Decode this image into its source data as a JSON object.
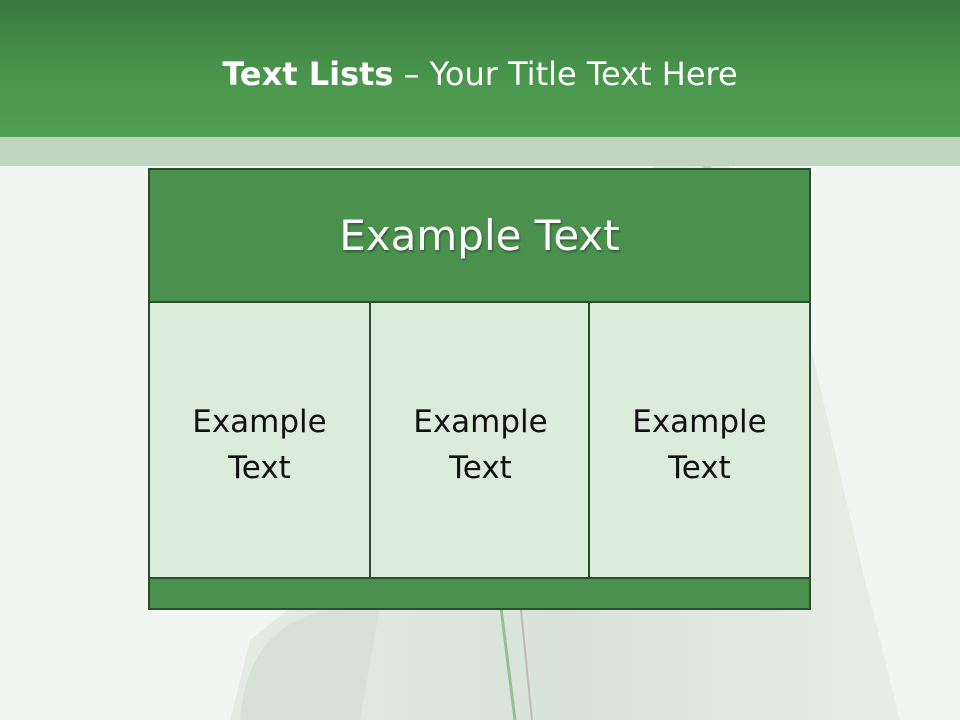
{
  "title": {
    "bold": "Text Lists",
    "rest": "– Your Title Text Here"
  },
  "panel": {
    "header": "Example Text",
    "columns": [
      {
        "line1": "Example",
        "line2": "Text"
      },
      {
        "line1": "Example",
        "line2": "Text"
      },
      {
        "line1": "Example",
        "line2": "Text"
      }
    ]
  },
  "colors": {
    "header_green": "#4a974d",
    "panel_green": "#4b914e",
    "cell_fill": "#dbecdb",
    "border": "#2c4d2d"
  }
}
